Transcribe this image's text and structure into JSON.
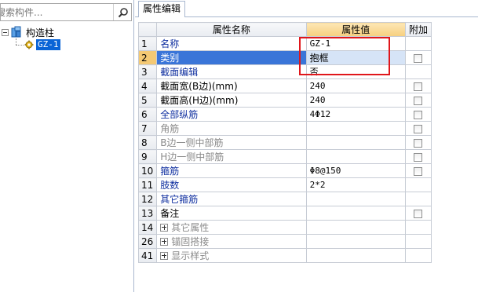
{
  "left_panel": {
    "search": {
      "placeholder": "搜索构件...",
      "value": ""
    },
    "tree": {
      "root_label": "构造柱",
      "child_label": "GZ-1"
    }
  },
  "right_panel": {
    "tab_label": "属性编辑",
    "columns": {
      "name": "属性名称",
      "value": "属性值",
      "extra": "附加"
    },
    "rows": [
      {
        "num": "1",
        "name": "名称",
        "value": "GZ-1",
        "style": "blue",
        "checkbox": false
      },
      {
        "num": "2",
        "name": "类别",
        "value": "抱框",
        "style": "selected",
        "checkbox": true
      },
      {
        "num": "3",
        "name": "截面编辑",
        "value": "否",
        "style": "blue",
        "checkbox": false
      },
      {
        "num": "4",
        "name": "截面宽(B边)(mm)",
        "value": "240",
        "style": "black",
        "checkbox": true
      },
      {
        "num": "5",
        "name": "截面高(H边)(mm)",
        "value": "240",
        "style": "black",
        "checkbox": true
      },
      {
        "num": "6",
        "name": "全部纵筋",
        "value": "4Φ12",
        "style": "blue",
        "checkbox": true
      },
      {
        "num": "7",
        "name": "角筋",
        "value": "",
        "style": "gray",
        "checkbox": true
      },
      {
        "num": "8",
        "name": "B边一侧中部筋",
        "value": "",
        "style": "gray",
        "checkbox": true
      },
      {
        "num": "9",
        "name": "H边一侧中部筋",
        "value": "",
        "style": "gray",
        "checkbox": true
      },
      {
        "num": "10",
        "name": "箍筋",
        "value": "Φ8@150",
        "style": "blue",
        "checkbox": true
      },
      {
        "num": "11",
        "name": "肢数",
        "value": "2*2",
        "style": "blue",
        "checkbox": false
      },
      {
        "num": "12",
        "name": "其它箍筋",
        "value": "",
        "style": "blue",
        "checkbox": false
      },
      {
        "num": "13",
        "name": "备注",
        "value": "",
        "style": "black",
        "checkbox": true
      },
      {
        "num": "14",
        "name": "其它属性",
        "value": "",
        "style": "gray-group",
        "checkbox": false
      },
      {
        "num": "26",
        "name": "锚固搭接",
        "value": "",
        "style": "gray-group",
        "checkbox": false
      },
      {
        "num": "41",
        "name": "显示样式",
        "value": "",
        "style": "gray-group",
        "checkbox": false
      }
    ]
  },
  "colors": {
    "selection": "#3a75d8",
    "value_header": "#f6cf7f",
    "highlight_box": "#e0161b",
    "link_text": "#1030a0"
  }
}
